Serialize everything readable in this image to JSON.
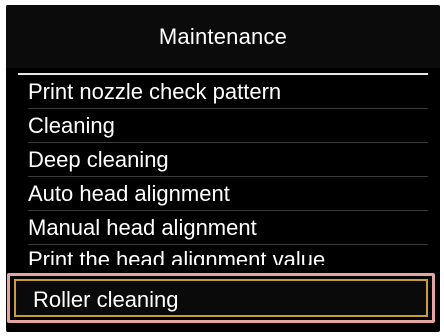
{
  "screen": {
    "title": "Maintenance"
  },
  "menu": {
    "items": [
      {
        "label": "Print nozzle check pattern"
      },
      {
        "label": "Cleaning"
      },
      {
        "label": "Deep cleaning"
      },
      {
        "label": "Auto head alignment"
      },
      {
        "label": "Manual head alignment"
      },
      {
        "label": "Print the head alignment value"
      },
      {
        "label": "Roller cleaning",
        "selected": true
      }
    ]
  },
  "colors": {
    "background": "#000000",
    "text": "#ffffff",
    "highlight_outer": "#e4a5a0",
    "highlight_inner": "#c8a030"
  }
}
